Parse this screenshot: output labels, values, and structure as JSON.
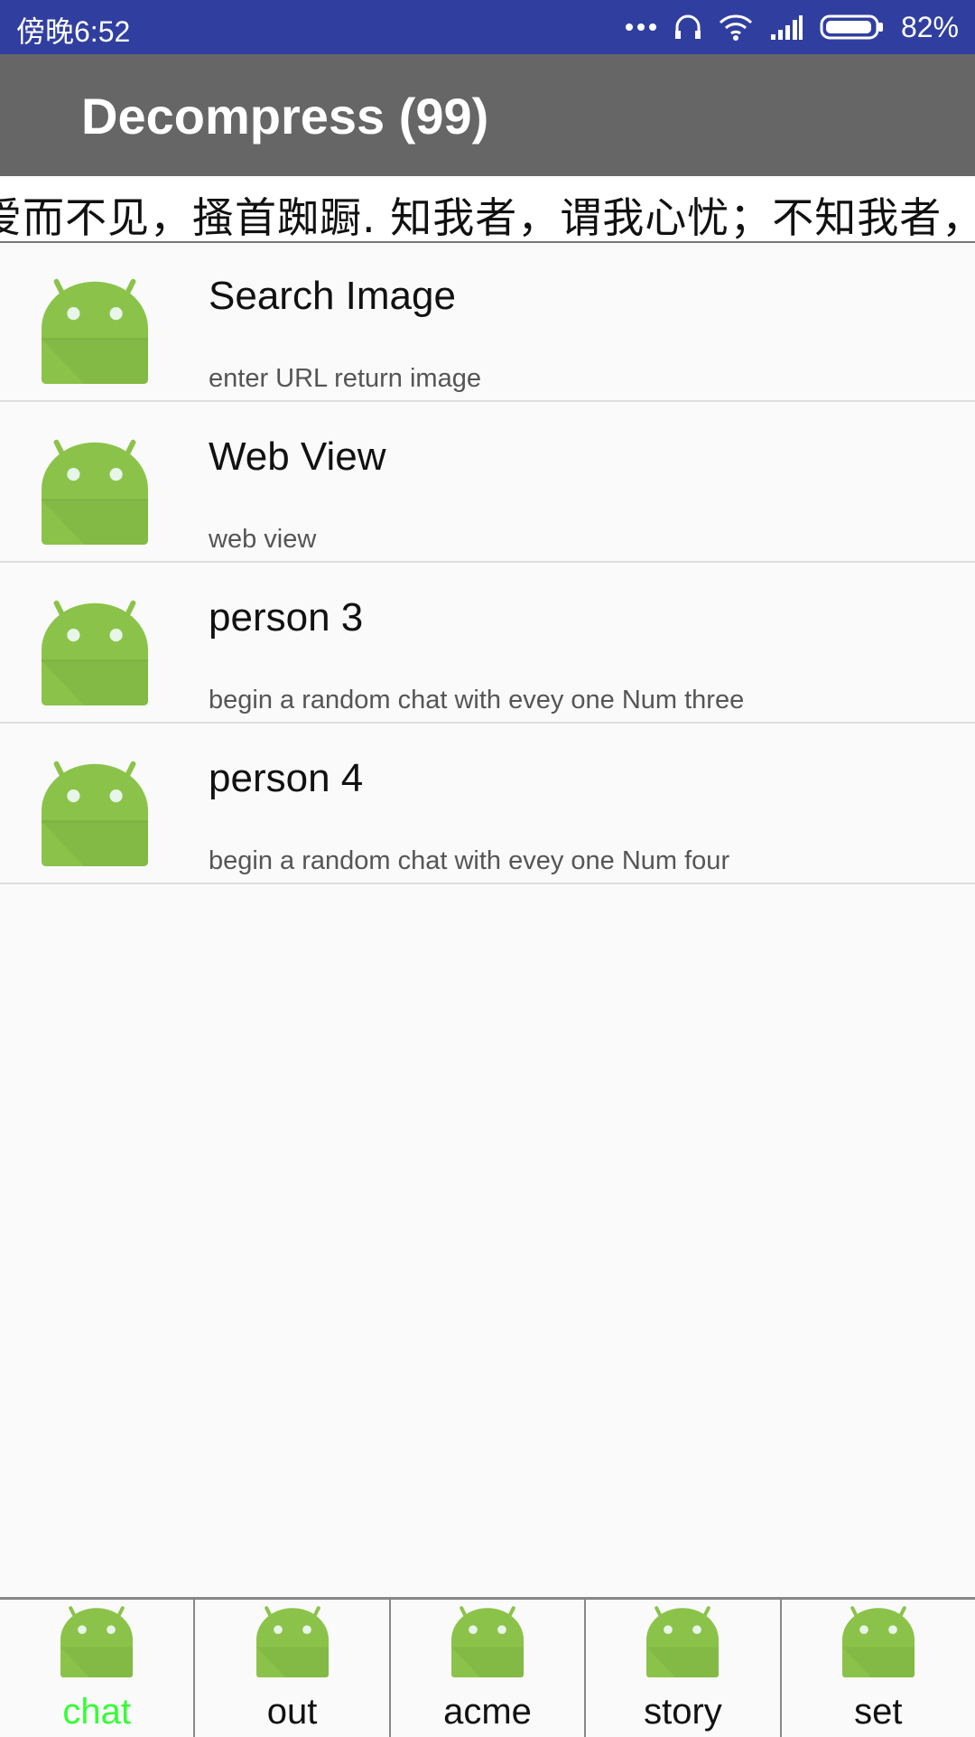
{
  "status_bar": {
    "time": "傍晚6:52",
    "battery_pct": "82%",
    "icons": [
      "more-dots-icon",
      "headphones-icon",
      "wifi-icon",
      "signal-icon",
      "battery-icon"
    ]
  },
  "app_bar": {
    "title": "Decompress (99)"
  },
  "marquee": {
    "text": "爱而不见，搔首踟蹰. 知我者，谓我心忧；不知我者，谓"
  },
  "list": [
    {
      "title": "Search Image",
      "subtitle": "enter URL return image",
      "icon": "android-icon"
    },
    {
      "title": "Web View",
      "subtitle": "web view",
      "icon": "android-icon"
    },
    {
      "title": "person 3",
      "subtitle": "begin a random chat with evey one Num three",
      "icon": "android-icon"
    },
    {
      "title": "person 4",
      "subtitle": "begin a random chat with evey one Num four",
      "icon": "android-icon"
    }
  ],
  "bottom_nav": [
    {
      "label": "chat",
      "active": true
    },
    {
      "label": "out",
      "active": false
    },
    {
      "label": "acme",
      "active": false
    },
    {
      "label": "story",
      "active": false
    },
    {
      "label": "set",
      "active": false
    }
  ],
  "colors": {
    "status_bar": "#303f9f",
    "app_bar": "#666666",
    "android_green": "#8bc34a",
    "active_tab": "#33ff33"
  }
}
